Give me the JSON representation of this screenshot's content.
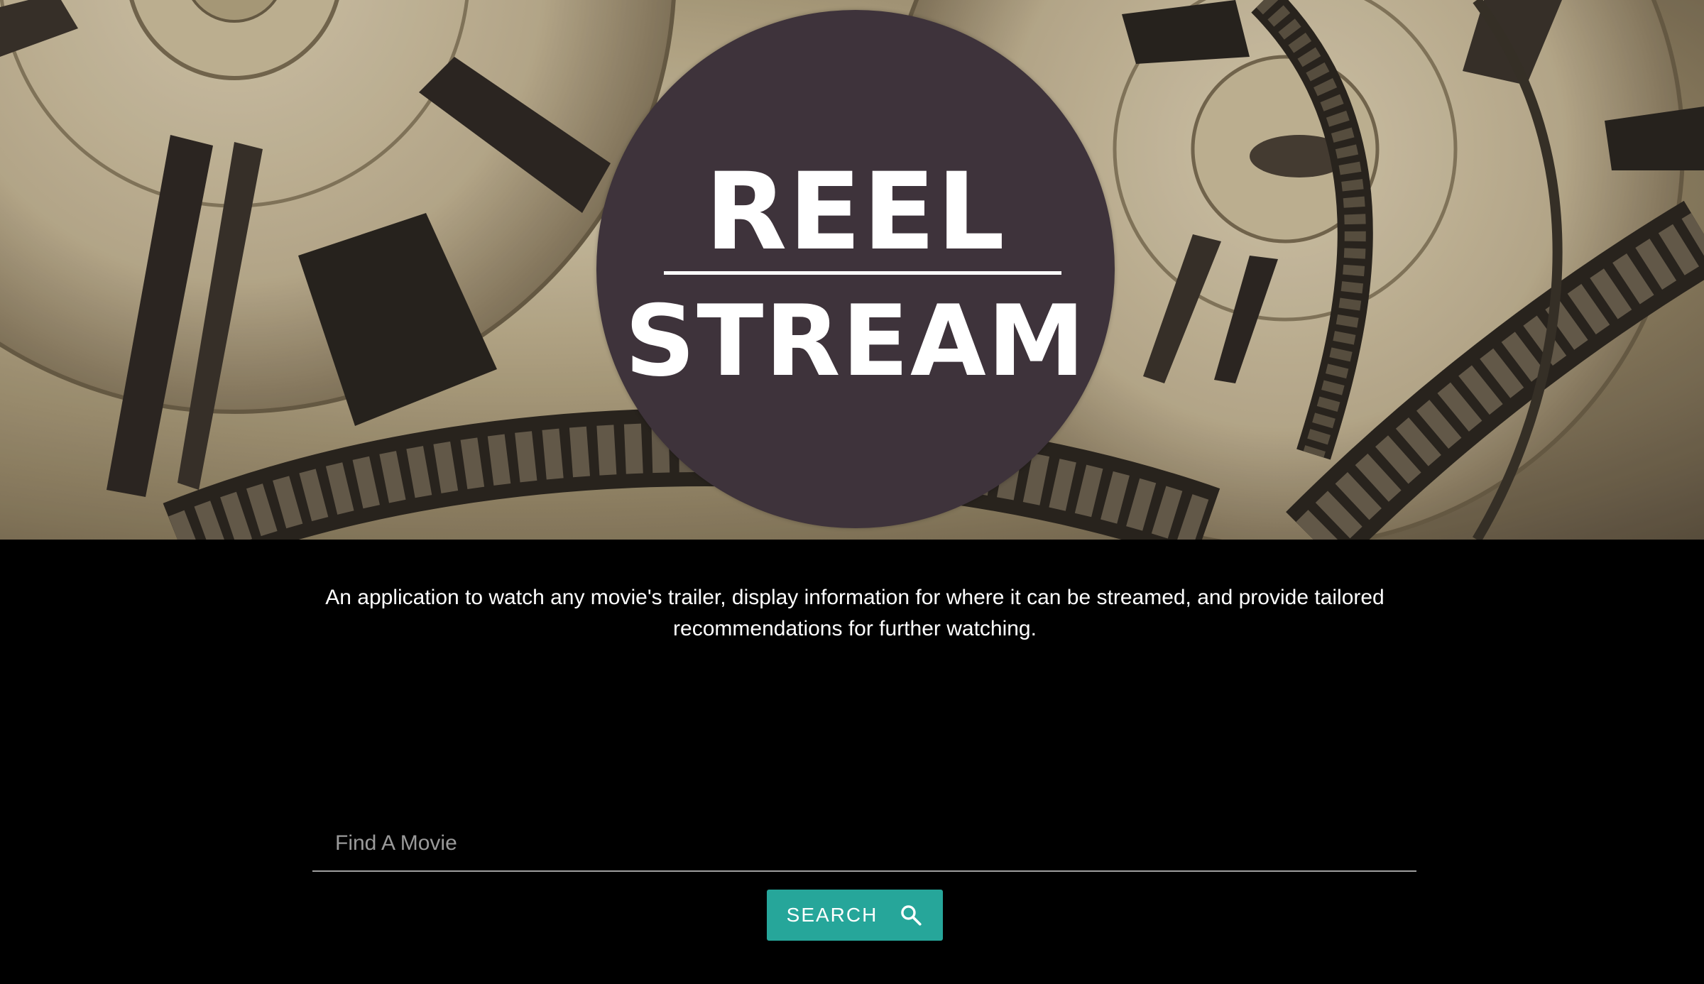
{
  "logo": {
    "line1": "REEL",
    "line2": "STREAM"
  },
  "description": "An application to watch any movie's trailer, display information for where it can be streamed, and provide tailored recommendations for further watching.",
  "search": {
    "placeholder": "Find A Movie",
    "value": "",
    "button_label": "SEARCH",
    "button_icon": "search-icon"
  },
  "colors": {
    "background": "#000000",
    "logo_circle": "#3e333b",
    "button": "#26a69a",
    "text": "#ffffff"
  }
}
